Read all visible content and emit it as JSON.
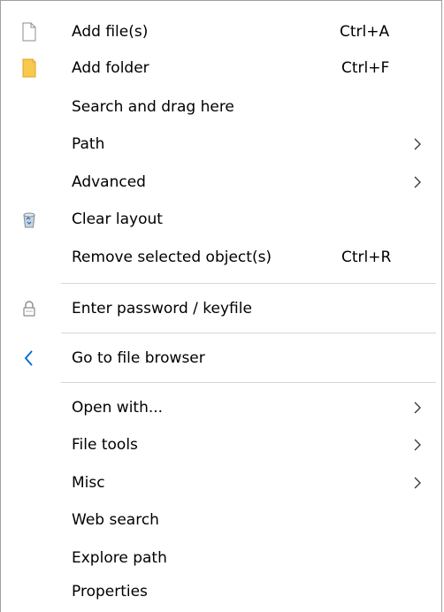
{
  "menu": {
    "items": [
      {
        "label": "Add file(s)",
        "shortcut": "Ctrl+A",
        "icon": "file-icon"
      },
      {
        "label": "Add folder",
        "shortcut": "Ctrl+F",
        "icon": "folder-icon"
      },
      {
        "label": "Search and drag here"
      },
      {
        "label": "Path",
        "submenu": true
      },
      {
        "label": "Advanced",
        "submenu": true
      },
      {
        "label": "Clear layout",
        "icon": "recycle-bin-icon"
      },
      {
        "label": "Remove selected object(s)",
        "shortcut": "Ctrl+R"
      },
      {
        "label": "Enter password / keyfile",
        "icon": "padlock-icon"
      },
      {
        "label": "Go to file browser",
        "icon": "back-arrow-icon"
      },
      {
        "label": "Open with...",
        "submenu": true
      },
      {
        "label": "File tools",
        "submenu": true
      },
      {
        "label": "Misc",
        "submenu": true
      },
      {
        "label": "Web search"
      },
      {
        "label": "Explore path"
      },
      {
        "label": "Properties"
      }
    ]
  },
  "colors": {
    "folder": "#f8c94a",
    "back_arrow": "#0066cc",
    "separator": "#d7d7d7"
  }
}
